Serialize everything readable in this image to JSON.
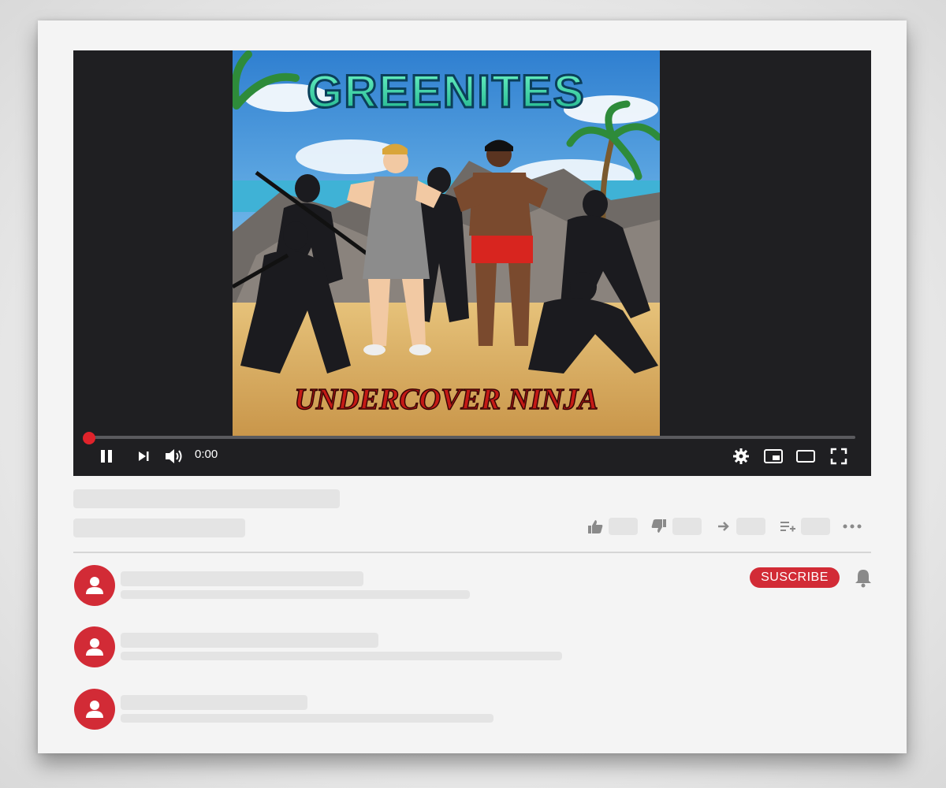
{
  "player": {
    "time": "0:00",
    "progress": 0,
    "thumbnail": {
      "title_text": "GREENITES",
      "subtitle_text": "UNDERCOVER NINJA"
    }
  },
  "channel": {
    "subscribe_label": "SUSCRIBE"
  },
  "icons": {
    "play_pause": "pause-icon",
    "next": "next-icon",
    "volume": "volume-icon",
    "settings": "gear-icon",
    "miniplayer": "miniplayer-icon",
    "theater": "theater-icon",
    "fullscreen": "fullscreen-icon",
    "like": "thumbs-up-icon",
    "dislike": "thumbs-down-icon",
    "share": "share-arrow-icon",
    "save": "playlist-add-icon",
    "more": "more-icon",
    "notify": "bell-icon",
    "avatar": "user-icon"
  },
  "colors": {
    "accent": "#d22b36",
    "player_bg": "#1f1f22",
    "skeleton": "#e4e4e4"
  }
}
